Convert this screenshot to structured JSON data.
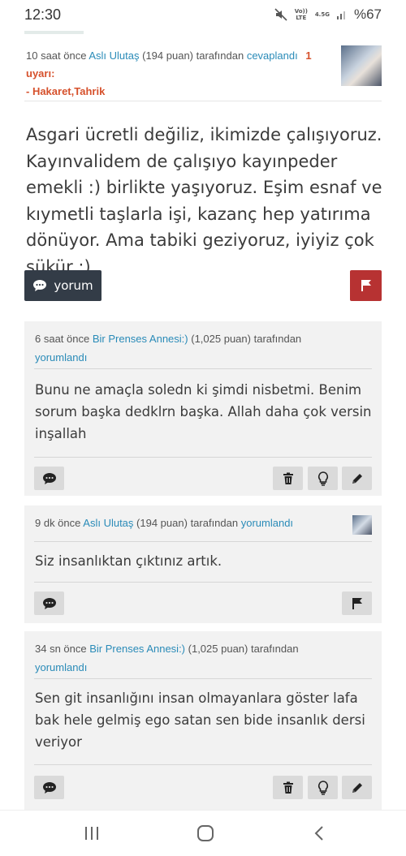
{
  "status_bar": {
    "time": "12:30",
    "volte": "Vo)) LTE",
    "network": "4.5G",
    "battery": "%67",
    "icons": [
      "mute-icon",
      "signal-icon"
    ]
  },
  "answer": {
    "time_ago": "10 saat önce",
    "author": "Aslı Ulutaş",
    "points": "(194 puan)",
    "by": "tarafından",
    "action": "cevaplandı",
    "warning_count": "1",
    "warning_word": "uyarı:",
    "warning_reason": "- Hakaret,Tahrik",
    "body": "Asgari ücretli değiliz, ikimizde çalışıyoruz. Kayınvalidem de çalışıyo kayınpeder emekli :) birlikte yaşıyoruz. Eşim esnaf ve kıymetli taşlarla işi,  kazanç hep yatırıma dönüyor. Ama tabiki geziyoruz, iyiyiz çok şükür :)",
    "comment_button_label": "yorum"
  },
  "comments": [
    {
      "time_ago": "6 saat önce",
      "author": "Bir Prenses Annesi:)",
      "points": "(1,025 puan)",
      "by": "tarafından",
      "action": "yorumlandı",
      "body": "Bunu ne amaçla soledn ki şimdi nisbetmi. Benim sorum başka dedklrn başka. Allah daha çok versin inşallah"
    },
    {
      "time_ago": "9 dk önce",
      "author": "Aslı Ulutaş",
      "points": "(194 puan)",
      "by": "tarafından",
      "action": "yorumlandı",
      "body": "Siz insanlıktan çıktınız artık."
    },
    {
      "time_ago": "34 sn önce",
      "author": "Bir Prenses Annesi:)",
      "points": "(1,025 puan)",
      "by": "tarafından",
      "action": "yorumlandı",
      "body": "Sen git insanlığını insan olmayanlara göster lafa bak hele gelmiş ego satan sen bide insanlık dersi veriyor"
    }
  ],
  "colors": {
    "link": "#2a8bb8",
    "warning": "#d6512c",
    "comment_button": "#333c47",
    "report_button": "#b73232",
    "comment_bg": "#f2f2f2"
  },
  "navigation": {
    "items": [
      "recent-apps-icon",
      "home-icon",
      "back-icon"
    ]
  }
}
